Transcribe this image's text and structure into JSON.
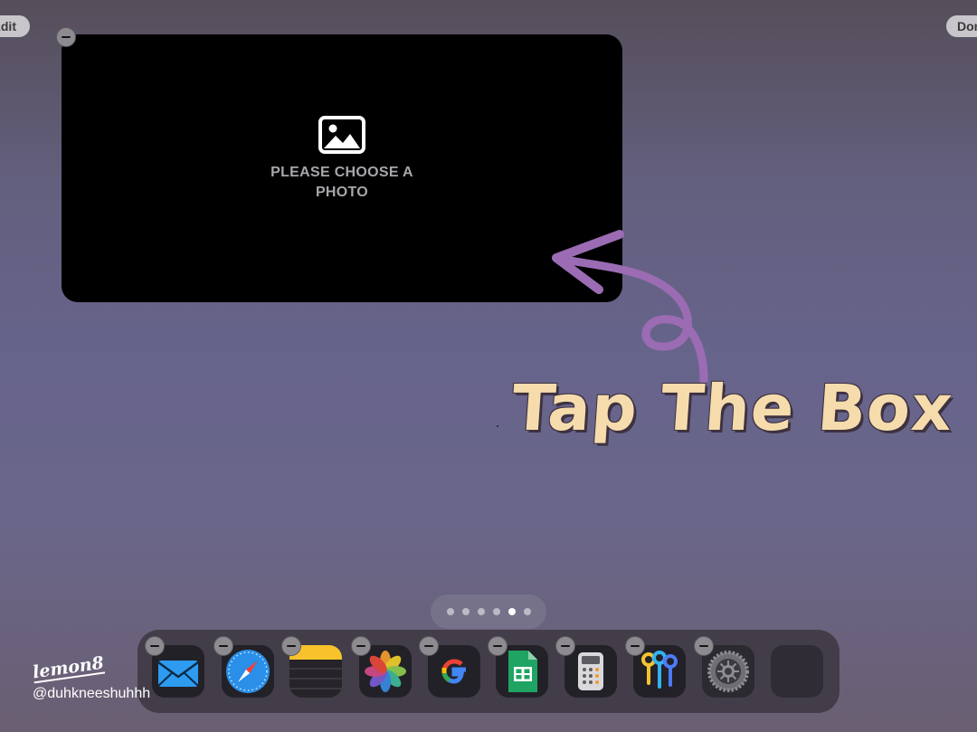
{
  "top_bar": {
    "edit_label": "Edit",
    "done_label": "Done"
  },
  "widget": {
    "message": "PLEASE CHOOSE A PHOTO",
    "icon": "photo-icon"
  },
  "annotation": {
    "text": "Tap The Box",
    "color": "#f6dcad",
    "arrow_color": "#9b6cb4"
  },
  "page_indicator": {
    "total": 6,
    "current": 5
  },
  "dock": {
    "apps": [
      {
        "name": "Mail",
        "icon": "mail-icon"
      },
      {
        "name": "Safari",
        "icon": "safari-icon"
      },
      {
        "name": "Notes",
        "icon": "notes-icon"
      },
      {
        "name": "Photos",
        "icon": "photos-icon"
      },
      {
        "name": "Google",
        "icon": "google-icon"
      },
      {
        "name": "Google Sheets",
        "icon": "sheets-icon"
      },
      {
        "name": "Calculator",
        "icon": "calculator-icon"
      },
      {
        "name": "Passwords",
        "icon": "keys-icon"
      },
      {
        "name": "Settings",
        "icon": "settings-icon"
      },
      {
        "name": "",
        "icon": "empty-slot"
      }
    ]
  },
  "watermark": {
    "logo": "lemon8",
    "handle": "@duhkneeshuhhh"
  }
}
